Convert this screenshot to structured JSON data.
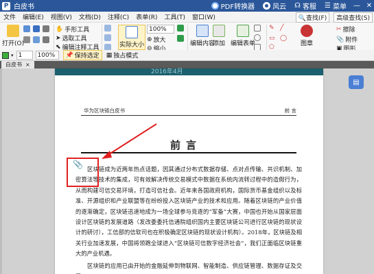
{
  "titlebar": {
    "app_initial": "P",
    "title": "白皮书",
    "pdf_converter": "PDF转换器",
    "cloud": "风云",
    "service": "客服",
    "menu": "菜单",
    "minimize": "—",
    "close": "✕"
  },
  "menubar": {
    "items": [
      "文件",
      "编辑(E)",
      "视图(V)",
      "文档(D)",
      "注释(C)",
      "表单(R)",
      "工具(T)",
      "窗口(W)"
    ],
    "search_tool": "查找(F)",
    "advanced_search": "高级查找(S)"
  },
  "ribbon": {
    "open": "打开(O)",
    "hand_tool": "手形工具",
    "select_tool": "选取工具",
    "edit_annotation_tool": "编辑注释工具",
    "actual_size": "实际大小",
    "zoom_value": "100%",
    "zoom_in": "放大",
    "zoom_out": "缩小",
    "edit_content": "编辑内容",
    "add": "添加",
    "edit_form": "编辑表单",
    "shapes": "线条",
    "stamp": "图章",
    "eraser": "擦除",
    "attach": "附件",
    "image": "图形"
  },
  "toolbar2": {
    "line_width": "1",
    "zoom_value": "100%",
    "keep_selected": "保持选定",
    "single_mode": "独占模式"
  },
  "tabs": {
    "active": "白皮书",
    "close": "×"
  },
  "page": {
    "prev_footer": "2016年4月",
    "header_left": "华为区块链白皮书",
    "header_right": "前 言",
    "chapter_title": "前言",
    "paragraphs": [
      "区块链成为近两年热点话题，因其通过分布式数据存储、点对点传输、共识机制、加密算法等技术的集成，可有效解决传统交易模式中数据在系统内流转过程中的造假行为，从而构建可信交易环境，打造可信社会。近年来各国政府机构，国际货币基金组织以及标准、开源组织和产业联盟等在纷纷投入区块链产业的技术和应用。随着区块链的产业价值的逐渐确定，区块链迅速地成为一场全球参与竞逐的“军备”大赛，中国也开始从国家层面设计区块链的发展道路（发改委委托信通院组织国内主要区块链公司进行区块链的现状设计的研讨），工信部的信软司也在积极确定区块链的现状设计机构）。2018年，区块链及相关行业加速发展，中国将领跑全球进入“区块链可信数字经济社会”，我们正面临区块链重大的产业机遇。",
      "区块链的应用已由开始的金融延伸到物联网、智能制造、供应链管理、数据存证及交易"
    ]
  },
  "colors": {
    "titlebar": "#2b579a",
    "annotation_box": "#e02020",
    "side_button": "#4a7fd4"
  }
}
